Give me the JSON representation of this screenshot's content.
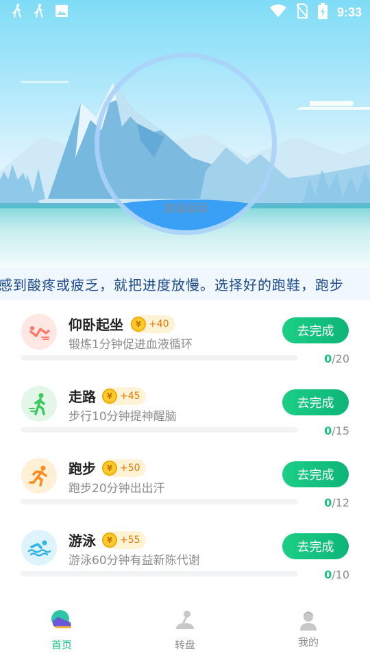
{
  "status_bar": {
    "time": "9:33",
    "left_icons": [
      "walking-person-icon",
      "walking-person-icon",
      "image-icon"
    ],
    "right_icons": [
      "wifi-icon",
      "no-sim-icon",
      "battery-charging-icon"
    ]
  },
  "hero": {
    "ring_label": "加油运动",
    "ring_fill_fraction": 0.18
  },
  "marquee": {
    "text": "感到酸疼或疲乏，就把进度放慢。选择好的跑鞋，跑步"
  },
  "tasks": [
    {
      "title": "仰卧起坐",
      "reward": "+40",
      "description": "锻炼1分钟促进血液循环",
      "button": "去完成",
      "done": "0",
      "total": "/20",
      "icon": "situp-icon",
      "icon_color": "#ff7b6b",
      "icon_bg": "#ffe7e3",
      "progress": 0
    },
    {
      "title": "走路",
      "reward": "+45",
      "description": "步行10分钟提神醒脑",
      "button": "去完成",
      "done": "0",
      "total": "/15",
      "icon": "walking-icon",
      "icon_color": "#3bc95a",
      "icon_bg": "#e2f7e7",
      "progress": 0
    },
    {
      "title": "跑步",
      "reward": "+50",
      "description": "跑步20分钟出出汗",
      "button": "去完成",
      "done": "0",
      "total": "/12",
      "icon": "running-icon",
      "icon_color": "#ff8a1c",
      "icon_bg": "#fff0d6",
      "progress": 0
    },
    {
      "title": "游泳",
      "reward": "+55",
      "description": "游泳60分钟有益新陈代谢",
      "button": "去完成",
      "done": "0",
      "total": "/10",
      "icon": "swimming-icon",
      "icon_color": "#2bb3ea",
      "icon_bg": "#def4fc",
      "progress": 0
    }
  ],
  "coin_symbol": "¥",
  "bottom_nav": [
    {
      "label": "首页",
      "icon": "sneaker-icon",
      "active": true
    },
    {
      "label": "转盘",
      "icon": "joystick-icon",
      "active": false
    },
    {
      "label": "我的",
      "icon": "user-icon",
      "active": false
    }
  ],
  "colors": {
    "accent_green": "#19c37d",
    "nav_active": "#19c37d",
    "nav_inactive": "#8c8c8c",
    "marquee_text": "#1a4a8c"
  }
}
